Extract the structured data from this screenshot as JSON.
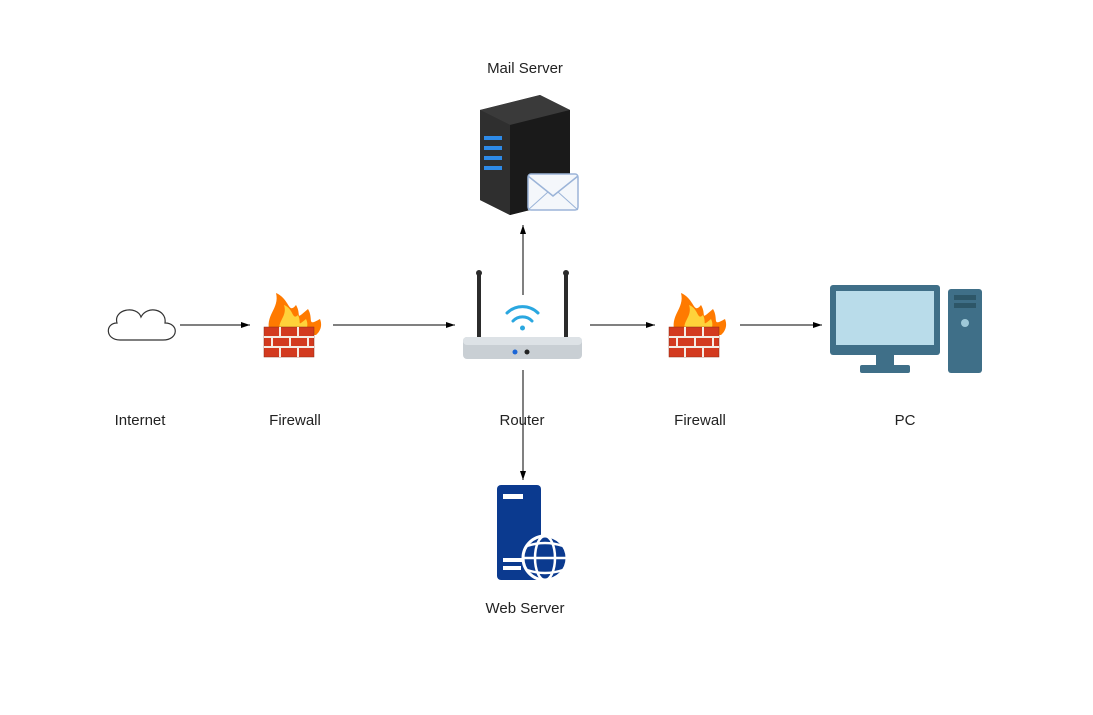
{
  "diagram": {
    "nodes": {
      "internet": {
        "label": "Internet",
        "icon": "cloud-icon"
      },
      "firewall1": {
        "label": "Firewall",
        "icon": "firewall-icon"
      },
      "router": {
        "label": "Router",
        "icon": "router-icon"
      },
      "firewall2": {
        "label": "Firewall",
        "icon": "firewall-icon"
      },
      "pc": {
        "label": "PC",
        "icon": "pc-icon"
      },
      "mailserver": {
        "label": "Mail Server",
        "icon": "mail-server-icon"
      },
      "webserver": {
        "label": "Web Server",
        "icon": "web-server-icon"
      }
    },
    "connections": [
      {
        "from": "internet",
        "to": "firewall1",
        "direction": "right"
      },
      {
        "from": "firewall1",
        "to": "router",
        "direction": "right"
      },
      {
        "from": "router",
        "to": "firewall2",
        "direction": "right"
      },
      {
        "from": "firewall2",
        "to": "pc",
        "direction": "right"
      },
      {
        "from": "router",
        "to": "mailserver",
        "direction": "up"
      },
      {
        "from": "router",
        "to": "webserver",
        "direction": "down"
      }
    ]
  }
}
